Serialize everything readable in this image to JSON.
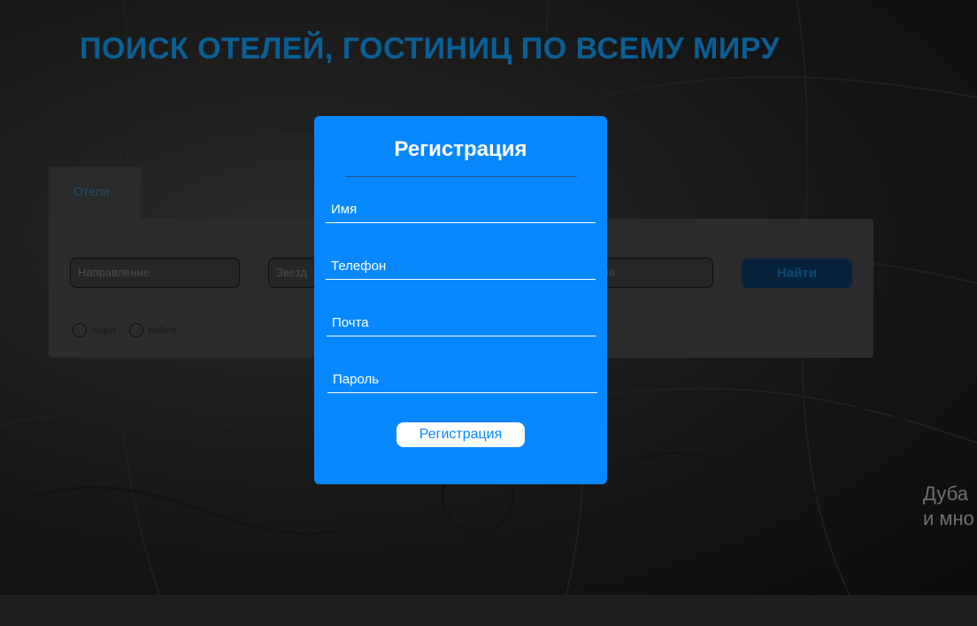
{
  "hero": {
    "title": "ПОИСК ОТЕЛЕЙ, ГОСТИНИЦ ПО ВСЕМУ МИРУ",
    "side_text_line1": "Дуба",
    "side_text_line2": "и мно"
  },
  "search": {
    "tab_label": "Отели",
    "destination_placeholder": "Направление",
    "stars_placeholder": "Звезд",
    "guests_placeholder": "ля",
    "find_button": "Найти",
    "radio_rest": "отдых",
    "radio_work": "работа"
  },
  "modal": {
    "title": "Регистрация",
    "name_placeholder": "Имя",
    "phone_placeholder": "Телефон",
    "email_placeholder": "Почта",
    "password_placeholder": "Пароль",
    "submit_label": "Регистрация"
  },
  "colors": {
    "accent": "#0888ff",
    "overlay": "#151515"
  }
}
